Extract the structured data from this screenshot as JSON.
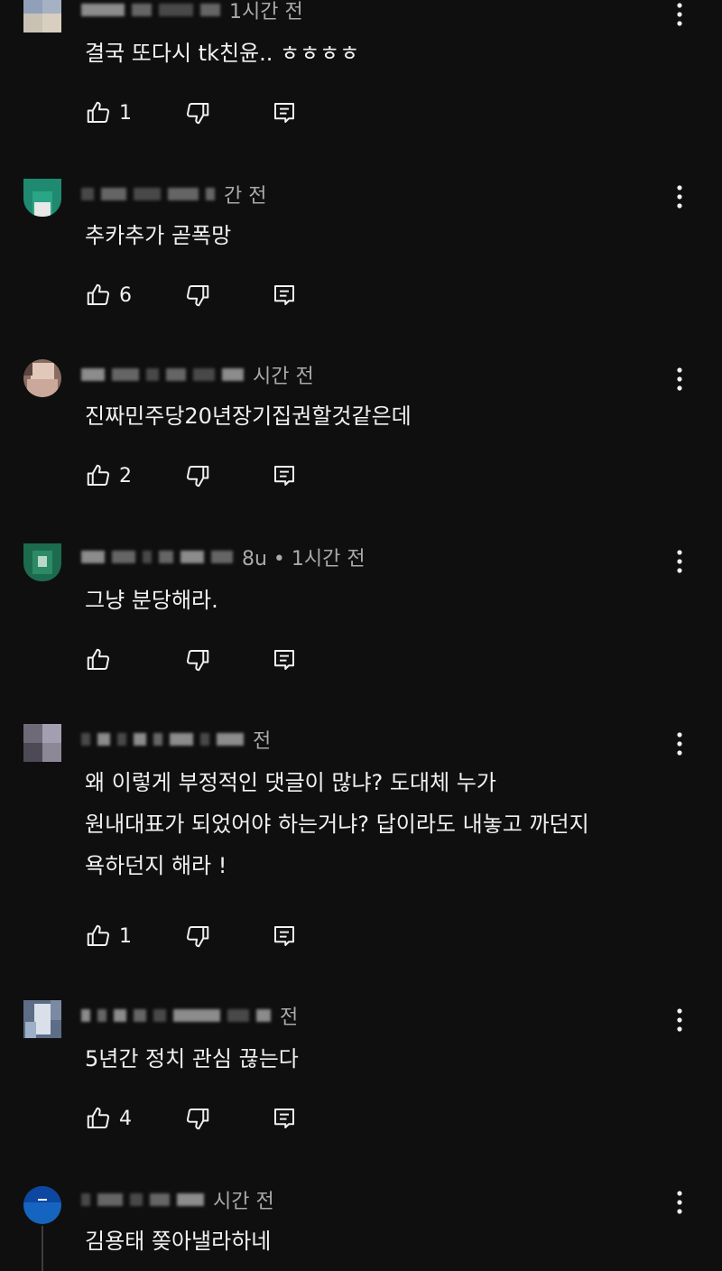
{
  "comments": [
    {
      "meta_suffix": "1시간 전",
      "body": [
        "결국 또다시 tk친윤..  ㅎㅎㅎㅎ"
      ],
      "likes": "1",
      "avatar_colors": [
        "#8fa0b8",
        "#c9c2b4",
        "#d8cfc0",
        "#a6b1c4"
      ]
    },
    {
      "meta_suffix": "간 전",
      "body": [
        "추카추가 곧폭망"
      ],
      "likes": "6",
      "avatar_colors": [
        "#1f8a70",
        "#2aa585",
        "#e8e8e8",
        "#1b7560"
      ]
    },
    {
      "meta_suffix": "시간 전",
      "body": [
        "진짜민주당20년장기집권할것같은데"
      ],
      "likes": "2",
      "avatar_colors": [
        "#caa99a",
        "#8a6d62",
        "#e2c8b8",
        "#5a4540"
      ]
    },
    {
      "meta_suffix": "8u • 1시간 전",
      "body": [
        "그냥 분당해라."
      ],
      "likes": "",
      "avatar_colors": [
        "#1d6b4f",
        "#2d8a66",
        "#b8d8c8",
        "#195a43"
      ]
    },
    {
      "meta_suffix": "전",
      "body": [
        "왜 이렇게 부정적인 댓글이 많냐? 도대체 누가",
        "원내대표가 되었어야 하는거냐? 답이라도 내놓고 까던지",
        "욕하던지 해라 !"
      ],
      "likes": "1",
      "avatar_colors": [
        "#6f6a78",
        "#8d8896",
        "#4d4a56",
        "#a39fb0"
      ]
    },
    {
      "meta_suffix": "전",
      "body": [
        "5년간 정치 관심 끊는다"
      ],
      "likes": "4",
      "avatar_colors": [
        "#9db0c8",
        "#5d6d86",
        "#d9e0ea",
        "#7a8aa2"
      ]
    },
    {
      "meta_suffix": "시간 전",
      "body": [
        "김용태 쫒아낼라하네"
      ],
      "likes": "",
      "avatar_colors": [
        "#1565c0",
        "#1e88e5",
        "#0d47a1",
        "#ffffff"
      ]
    }
  ]
}
